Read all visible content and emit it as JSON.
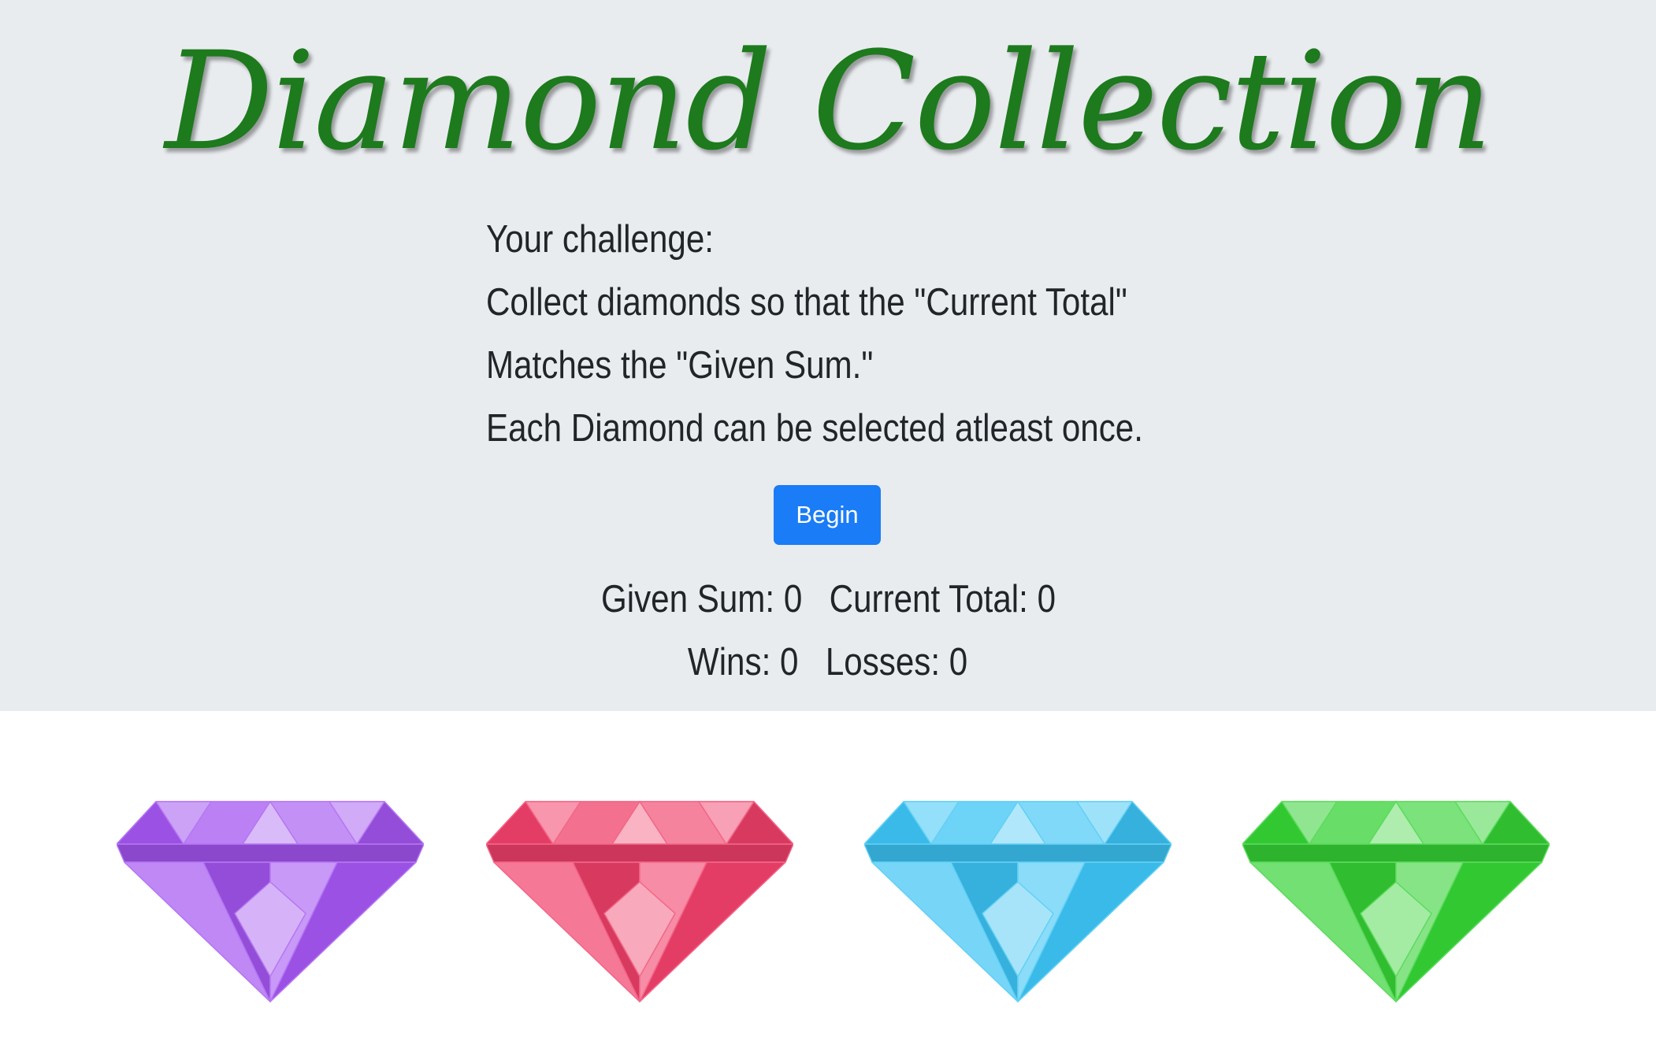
{
  "header": {
    "title": "Diamond Collection"
  },
  "instructions": [
    "Your challenge:",
    "Collect diamonds so that the \"Current Total\"",
    "Matches the \"Given Sum.\"",
    "Each Diamond can be selected atleast once."
  ],
  "controls": {
    "begin_label": "Begin"
  },
  "scoreboard": {
    "given_sum_label": "Given Sum:",
    "given_sum_value": "0",
    "current_total_label": "Current Total:",
    "current_total_value": "0",
    "wins_label": "Wins:",
    "wins_value": "0",
    "losses_label": "Losses:",
    "losses_value": "0"
  },
  "colors": {
    "title": "#1d7a1d",
    "jumbotron_bg": "#e9ecef",
    "button_bg": "#1a7cf6",
    "gems": [
      "#a355f0",
      "#f0406a",
      "#3cc4f4",
      "#35d235"
    ]
  },
  "gems": [
    {
      "name": "purple-diamond",
      "color": "#a355f0"
    },
    {
      "name": "red-diamond",
      "color": "#f0406a"
    },
    {
      "name": "blue-diamond",
      "color": "#3cc4f4"
    },
    {
      "name": "green-diamond",
      "color": "#35d235"
    }
  ]
}
